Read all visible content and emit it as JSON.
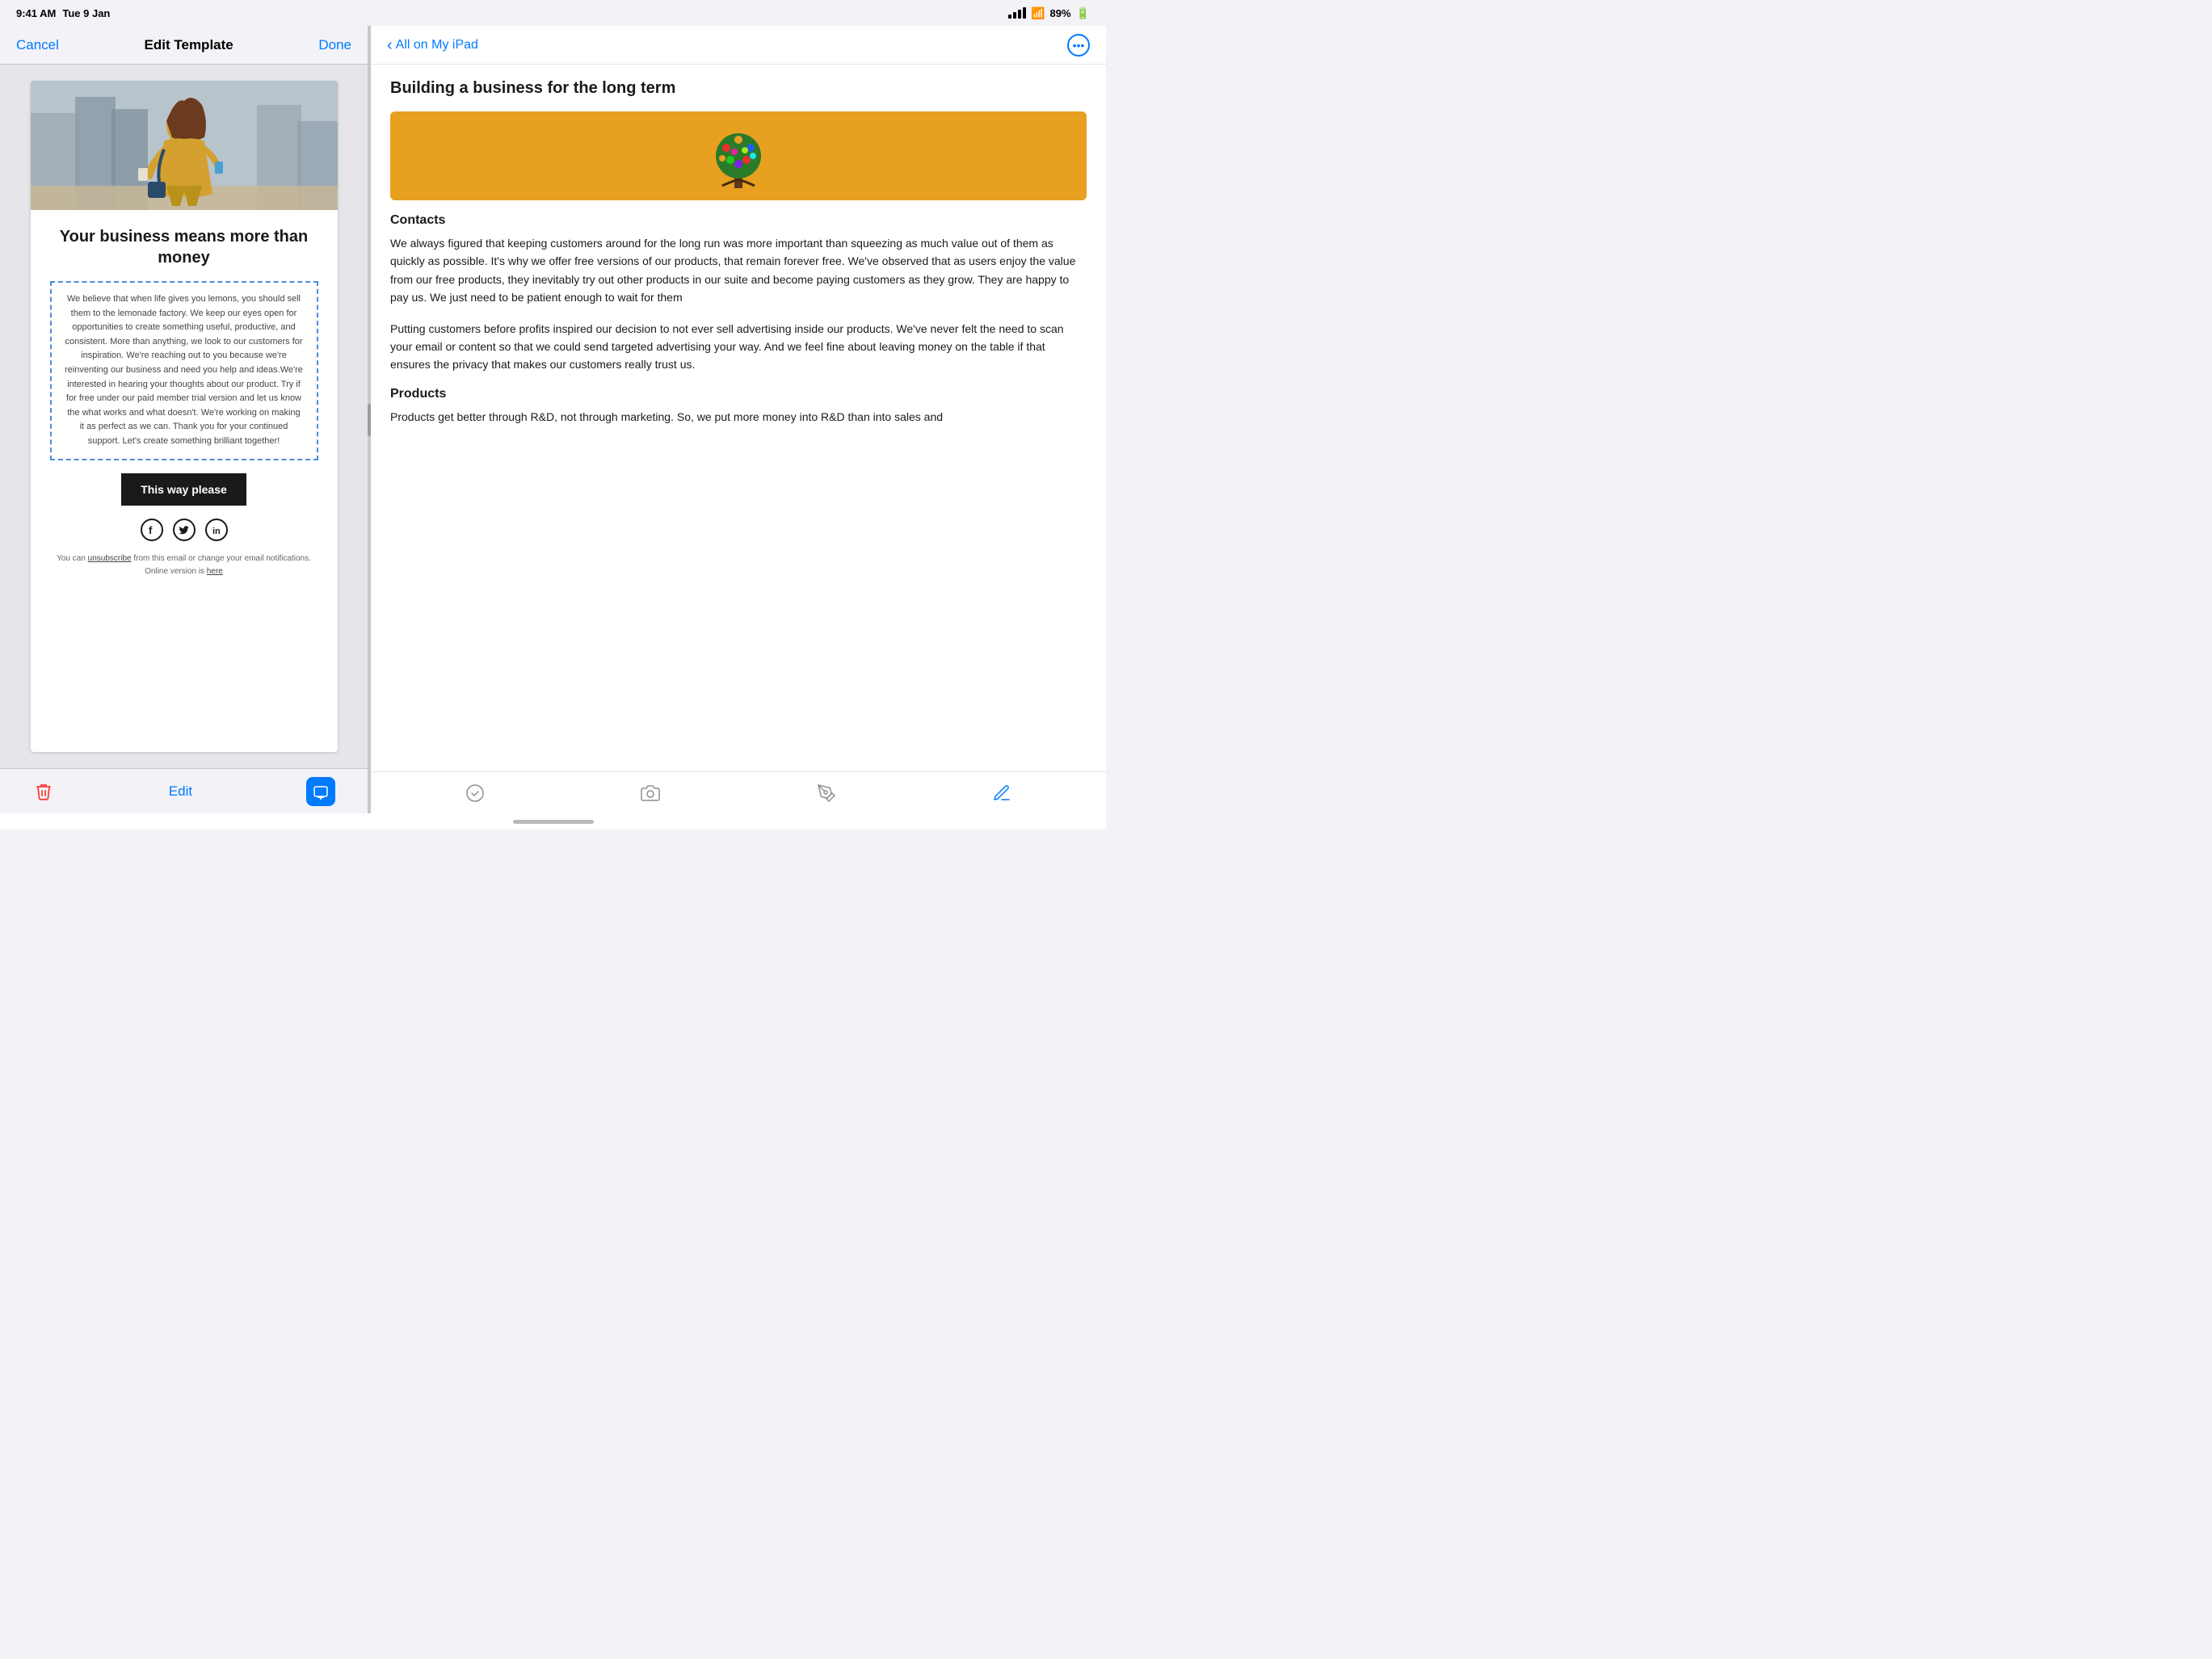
{
  "status_bar": {
    "time": "9:41 AM",
    "date": "Tue 9 Jan",
    "battery": "89%"
  },
  "left_panel": {
    "nav": {
      "cancel_label": "Cancel",
      "title": "Edit Template",
      "done_label": "Done"
    },
    "email": {
      "headline": "Your business means more than money",
      "body_text": "We believe that when life gives you lemons, you should sell them to the lemonade factory. We keep our eyes open for opportunities to create something useful, productive, and consistent. More than anything, we look to our customers for inspiration. We're reaching out to you because we're reinventing our business and need you help and ideas.We're interested in hearing your thoughts about our product. Try if for free under our paid member trial version and let us know the what works and what doesn't. We're working on making it as perfect as we can. Thank you for your continued support. Let's create something brilliant together!",
      "cta_button": "This way please",
      "footer_text": "You can unsubscribe from this email or change your email notifications.",
      "footer_link_text": "Online version is here",
      "unsubscribe_label": "unsubscribe",
      "here_label": "here"
    },
    "toolbar": {
      "edit_label": "Edit"
    }
  },
  "right_panel": {
    "nav": {
      "back_label": "All on My iPad"
    },
    "note": {
      "title": "Building a business for the long term",
      "contacts_heading": "Contacts",
      "contacts_text_1": "We always figured that keeping customers around for the long run was more important than squeezing as much value out of them as quickly as possible. It's why we offer free versions of our products, that remain forever free. We've observed that as users enjoy the value from our free products, they inevitably try out other products in our suite and become paying customers as they grow. They are happy to pay us. We just need to be patient enough to wait for them",
      "contacts_text_2": "Putting customers before profits inspired our decision to not ever sell advertising inside our products. We've never felt the need to scan your email or content so that we could send targeted advertising your way. And we feel fine about leaving money on the table if that ensures the privacy that makes our customers really trust us.",
      "products_heading": "Products",
      "products_text": "Products get better through R&D, not through marketing. So, we put more money into R&D than into sales and"
    }
  }
}
